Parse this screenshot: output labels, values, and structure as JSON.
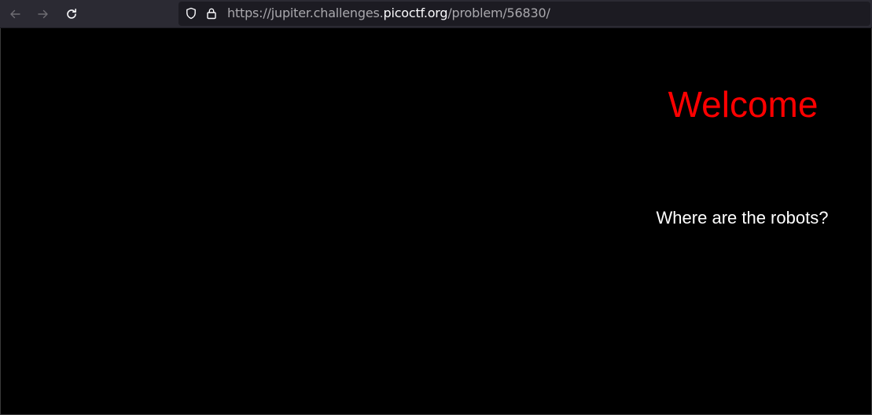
{
  "browser": {
    "url": {
      "scheme_prefix": "https://jupiter.challenges.",
      "domain": "picoctf.org",
      "path": "/problem/56830/"
    },
    "icons": {
      "back": "arrow-left-icon",
      "forward": "arrow-right-icon",
      "reload": "reload-icon",
      "tracking": "shield-icon",
      "security": "lock-icon"
    }
  },
  "page": {
    "heading": "Welcome",
    "message": "Where are the robots?"
  },
  "colors": {
    "heading": "#ff0000",
    "message": "#ffffff",
    "background": "#000000",
    "toolbar": "#2b2a33",
    "urlbar": "#1c1b22"
  }
}
